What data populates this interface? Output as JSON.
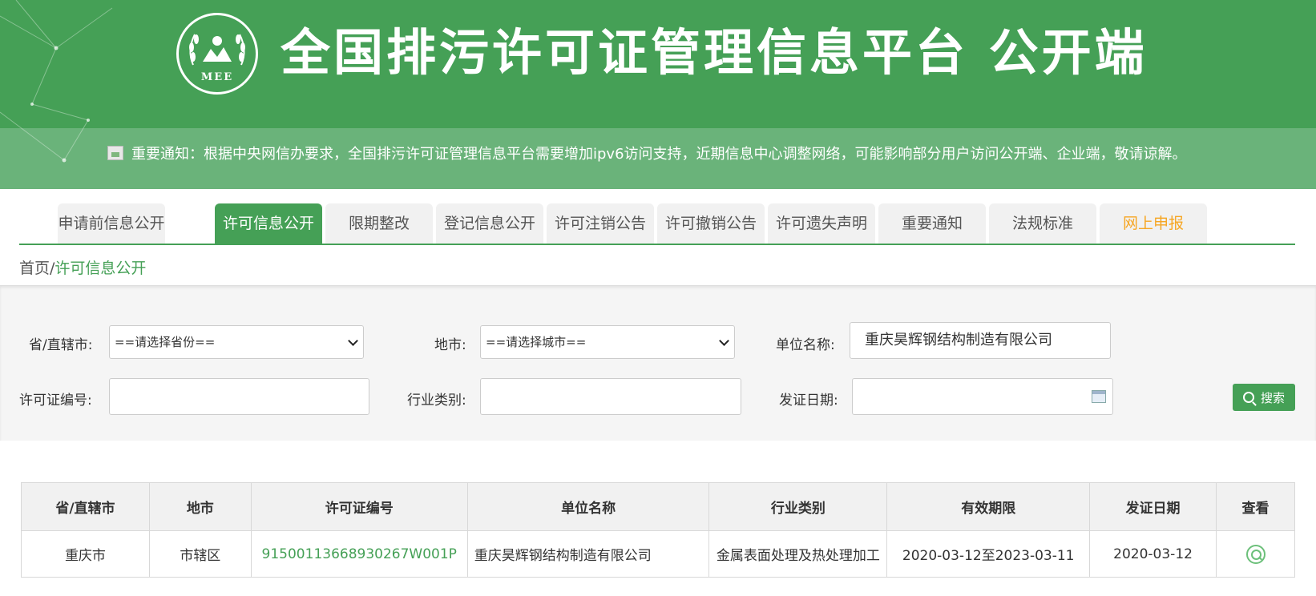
{
  "header": {
    "logo_text": "MEE",
    "title": "全国排污许可证管理信息平台  公开端",
    "notice": "重要通知：根据中央网信办要求，全国排污许可证管理信息平台需要增加ipv6访问支持，近期信息中心调整网络，可能影响部分用户访问公开端、企业端，敬请谅解。"
  },
  "tabs": [
    {
      "label": "申请前信息公开"
    },
    {
      "label": "许可信息公开"
    },
    {
      "label": "限期整改"
    },
    {
      "label": "登记信息公开"
    },
    {
      "label": "许可注销公告"
    },
    {
      "label": "许可撤销公告"
    },
    {
      "label": "许可遗失声明"
    },
    {
      "label": "重要通知"
    },
    {
      "label": "法规标准"
    },
    {
      "label": "网上申报"
    }
  ],
  "breadcrumb": {
    "home": "首页",
    "separator": "/",
    "current": "许可信息公开"
  },
  "search": {
    "province_label": "省/直辖市:",
    "province_value": "==请选择省份==",
    "city_label": "地市:",
    "city_value": "==请选择城市==",
    "unit_label": "单位名称:",
    "unit_value": "重庆昊辉钢结构制造有限公司",
    "license_label": "许可证编号:",
    "license_value": "",
    "industry_label": "行业类别:",
    "industry_value": "",
    "date_label": "发证日期:",
    "date_value": "",
    "button_label": "搜索"
  },
  "table": {
    "headers": [
      "省/直辖市",
      "地市",
      "许可证编号",
      "单位名称",
      "行业类别",
      "有效期限",
      "发证日期",
      "查看"
    ],
    "rows": [
      {
        "province": "重庆市",
        "city": "市辖区",
        "license_no": "91500113668930267W001P",
        "unit_name": "重庆昊辉钢结构制造有限公司",
        "industry": "金属表面处理及热处理加工",
        "validity": "2020-03-12至2023-03-11",
        "issue_date": "2020-03-12"
      }
    ]
  },
  "colors": {
    "brand_green": "#45a056",
    "header_band": "#6ab37a",
    "highlight_orange": "#f6a623"
  }
}
